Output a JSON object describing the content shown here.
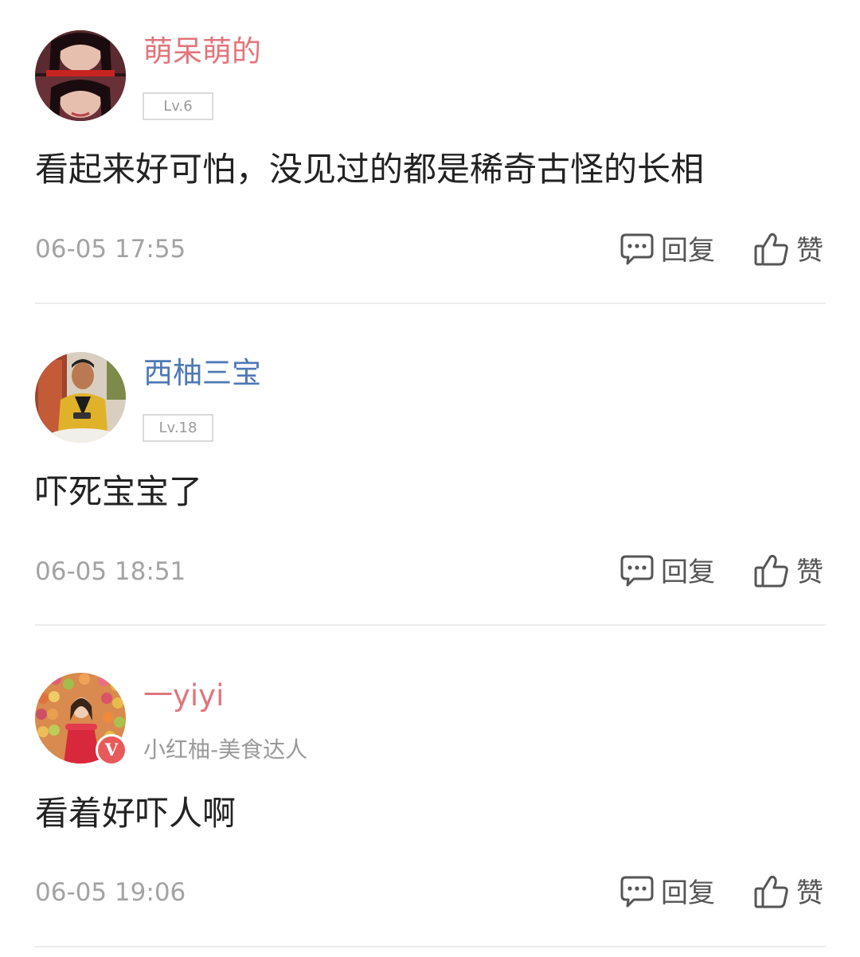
{
  "comments": [
    {
      "username": "萌呆萌的",
      "username_color": "#e2747b",
      "level": "Lv.6",
      "text": "看起来好可怕，没见过的都是稀奇古怪的长相",
      "time": "06-05 17:55",
      "reply_label": "回复",
      "like_label": "赞"
    },
    {
      "username": "西柚三宝",
      "username_color": "#4f78b5",
      "level": "Lv.18",
      "text": "吓死宝宝了",
      "time": "06-05 18:51",
      "reply_label": "回复",
      "like_label": "赞"
    },
    {
      "username": "一yiyi",
      "username_color": "#e2747b",
      "subtitle": "小红柚-美食达人",
      "verified_badge": "V",
      "text": "看着好吓人啊",
      "time": "06-05 19:06",
      "reply_label": "回复",
      "like_label": "赞"
    }
  ],
  "icons": {
    "reply": "comment-bubble-icon",
    "like": "thumbs-up-icon"
  }
}
